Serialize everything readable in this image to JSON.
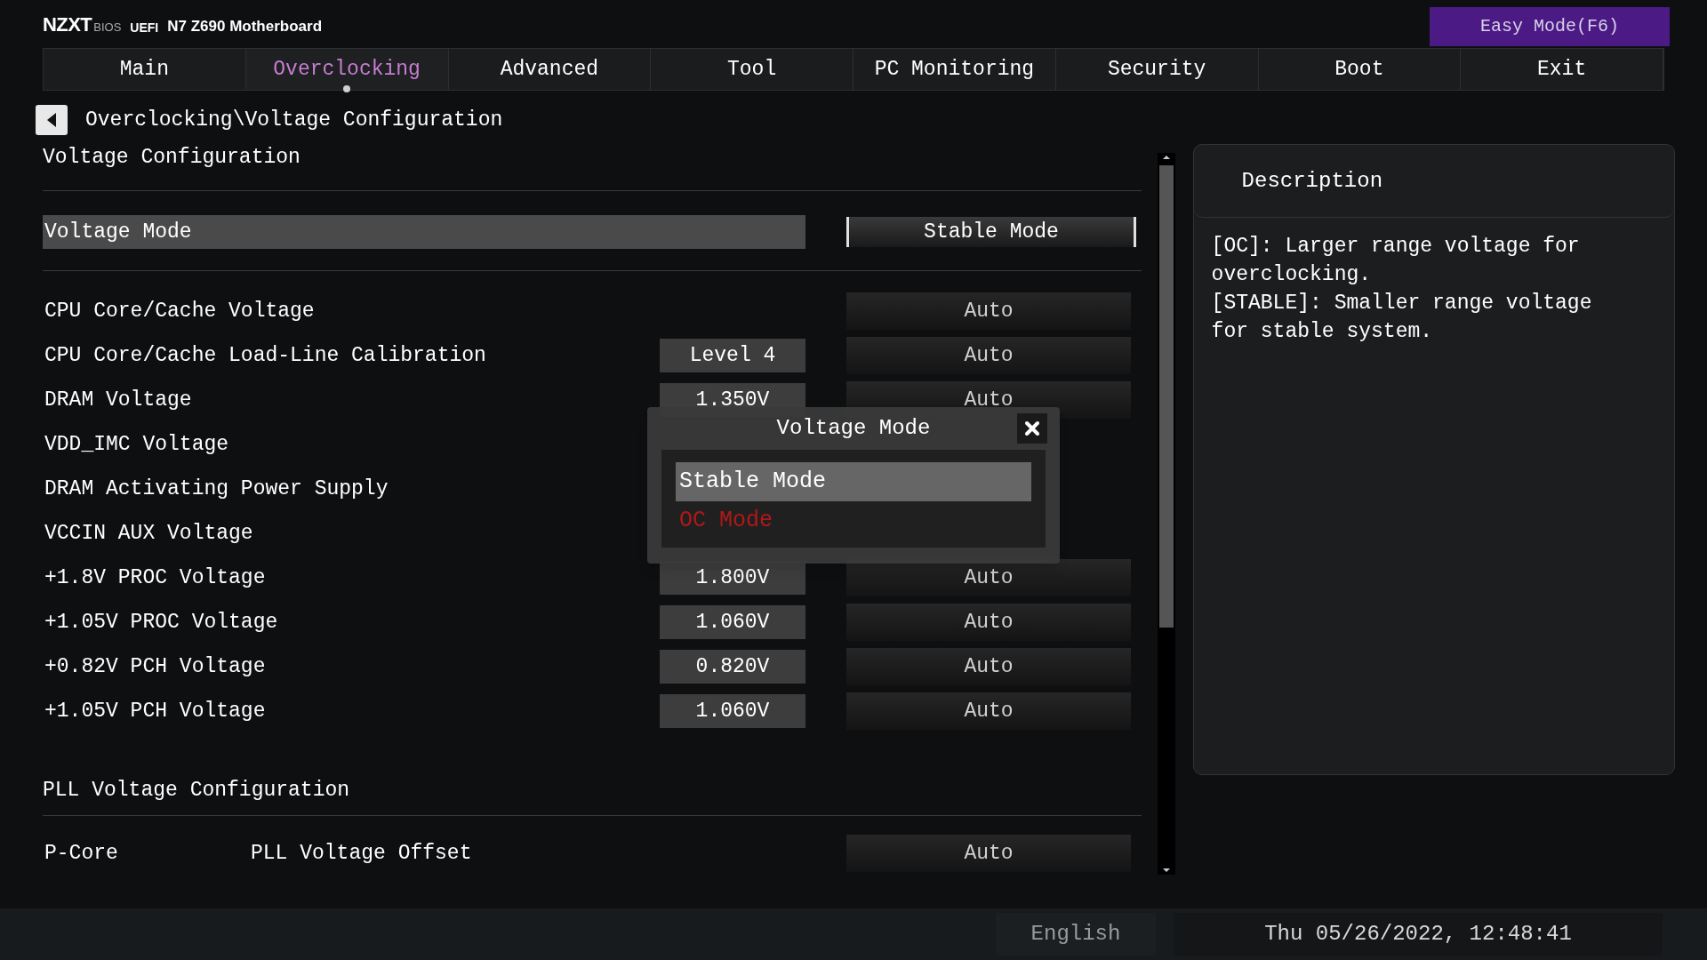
{
  "header": {
    "brand": "NZXT",
    "bios": "BIOS",
    "uefi": "UEFI",
    "model": "N7 Z690 Motherboard",
    "easy_mode": "Easy Mode(F6)"
  },
  "tabs": [
    {
      "label": "Main",
      "selected": false
    },
    {
      "label": "Overclocking",
      "selected": true
    },
    {
      "label": "Advanced",
      "selected": false
    },
    {
      "label": "Tool",
      "selected": false
    },
    {
      "label": "PC Monitoring",
      "selected": false
    },
    {
      "label": "Security",
      "selected": false
    },
    {
      "label": "Boot",
      "selected": false
    },
    {
      "label": "Exit",
      "selected": false
    }
  ],
  "breadcrumb": "Overclocking\\Voltage Configuration",
  "section_title": "Voltage Configuration",
  "items": [
    {
      "kind": "select",
      "label": "Voltage Mode",
      "setting": "Stable Mode",
      "selected": true
    },
    {
      "kind": "row",
      "label": "CPU Core/Cache Voltage",
      "setting": "Auto"
    },
    {
      "kind": "row",
      "label": "CPU Core/Cache Load-Line Calibration",
      "value": "Level 4",
      "setting": "Auto"
    },
    {
      "kind": "row",
      "label": "DRAM Voltage",
      "value": "1.350V",
      "setting": "Auto"
    },
    {
      "kind": "row",
      "label": "VDD_IMC Voltage"
    },
    {
      "kind": "row",
      "label": "DRAM Activating Power Supply"
    },
    {
      "kind": "row",
      "label": "VCCIN AUX Voltage"
    },
    {
      "kind": "row",
      "label": "+1.8V PROC Voltage",
      "value": "1.800V",
      "setting": "Auto"
    },
    {
      "kind": "row",
      "label": "+1.05V PROC Voltage",
      "value": "1.060V",
      "setting": "Auto"
    },
    {
      "kind": "row",
      "label": "+0.82V PCH Voltage",
      "value": "0.820V",
      "setting": "Auto"
    },
    {
      "kind": "row",
      "label": "+1.05V PCH Voltage",
      "value": "1.060V",
      "setting": "Auto"
    },
    {
      "kind": "heading",
      "label": "PLL Voltage Configuration"
    },
    {
      "kind": "pll",
      "label": "P-Core",
      "sublabel": "PLL Voltage Offset",
      "setting": "Auto"
    }
  ],
  "description": {
    "title": "Description",
    "lines": [
      "[OC]: Larger range voltage for overclocking.",
      "[STABLE]: Smaller range voltage for stable system."
    ]
  },
  "popup": {
    "title": "Voltage Mode",
    "options": [
      {
        "label": "Stable Mode",
        "selected": true
      },
      {
        "label": "OC Mode",
        "selected": false
      }
    ]
  },
  "status_bar": {
    "language": "English",
    "datetime": "Thu 05/26/2022, 12:48:41"
  }
}
